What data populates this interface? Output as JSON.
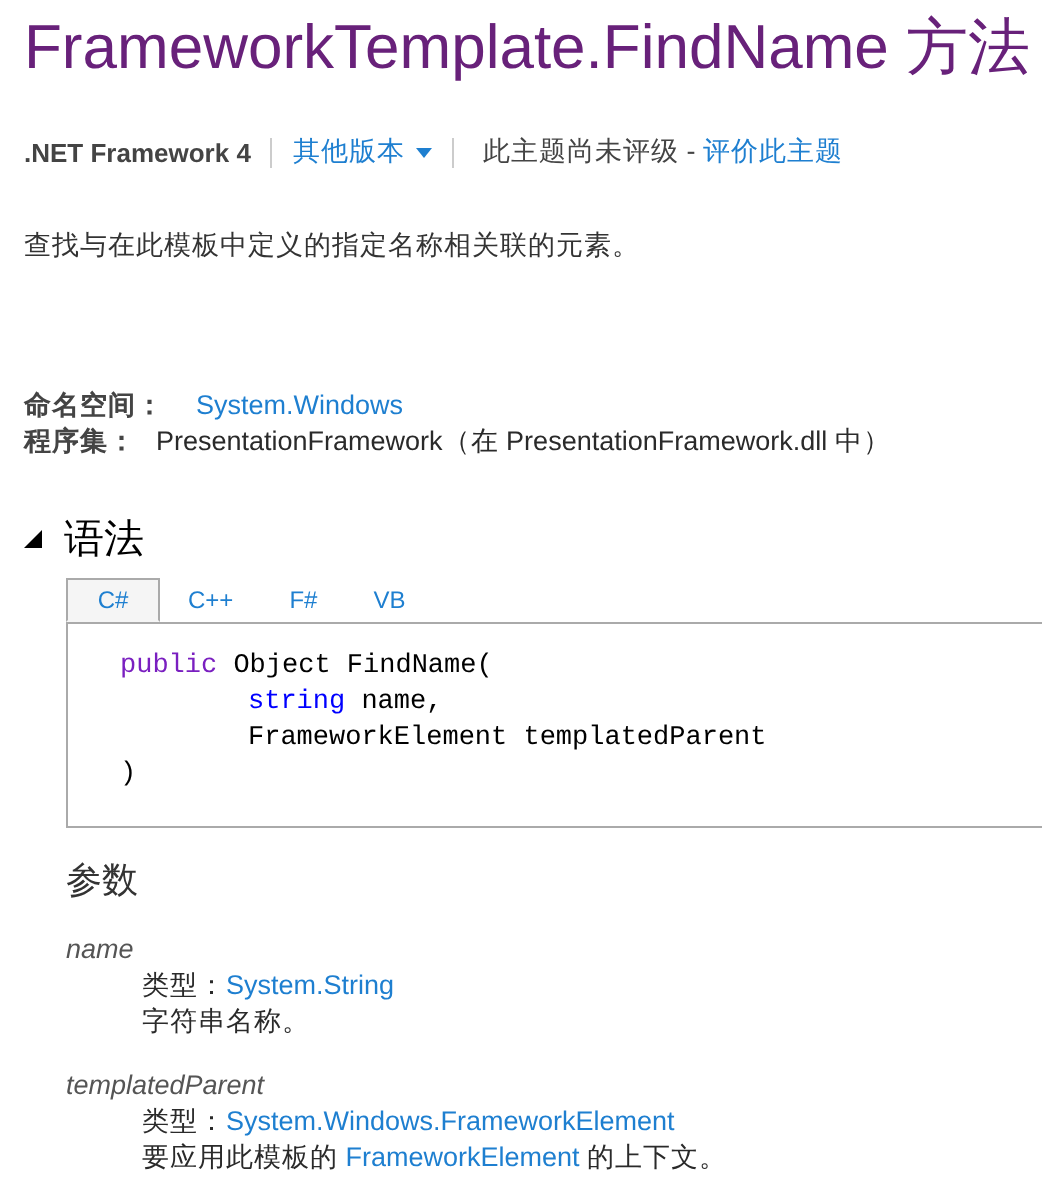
{
  "title": "FrameworkTemplate.FindName 方法",
  "meta": {
    "framework": ".NET Framework 4",
    "other_versions": "其他版本",
    "rating": "此主题尚未评级 - ",
    "rate_link": "评价此主题"
  },
  "summary": "查找与在此模板中定义的指定名称相关联的元素。",
  "namespace": {
    "label": "命名空间：",
    "value": "System.Windows"
  },
  "assembly": {
    "label": "程序集：",
    "value": "PresentationFramework（在 PresentationFramework.dll 中）"
  },
  "syntax": {
    "heading": "语法",
    "expanded": true,
    "tabs": [
      {
        "label": "C#",
        "selected": true
      },
      {
        "label": "C++",
        "selected": false
      },
      {
        "label": "F#",
        "selected": false
      },
      {
        "label": "VB",
        "selected": false
      }
    ],
    "code_lines": [
      {
        "kind": "signature",
        "parts": [
          {
            "text": "public",
            "kind": "keyword"
          },
          {
            "text": " Object FindName(",
            "kind": "plain"
          }
        ]
      },
      {
        "kind": "param",
        "parts": [
          {
            "text": "string",
            "kind": "keyword"
          },
          {
            "text": " name,",
            "kind": "plain"
          }
        ]
      },
      {
        "kind": "param",
        "parts": [
          {
            "text": "FrameworkElement templatedParent",
            "kind": "plain"
          }
        ]
      },
      {
        "kind": "close",
        "parts": [
          {
            "text": ")",
            "kind": "plain"
          }
        ]
      }
    ]
  },
  "parameters": {
    "heading": "参数",
    "items": [
      {
        "name": "name",
        "type_label": "类型：",
        "type": "System.String",
        "description": [
          {
            "text": "字符串名称。",
            "kind": "plain"
          }
        ]
      },
      {
        "name": "templatedParent",
        "type_label": "类型：",
        "type": "System.Windows.FrameworkElement",
        "description": [
          {
            "text": "要应用此模板的 ",
            "kind": "plain"
          },
          {
            "text": "FrameworkElement",
            "kind": "link"
          },
          {
            "text": " 的上下文。",
            "kind": "plain"
          }
        ]
      }
    ]
  }
}
